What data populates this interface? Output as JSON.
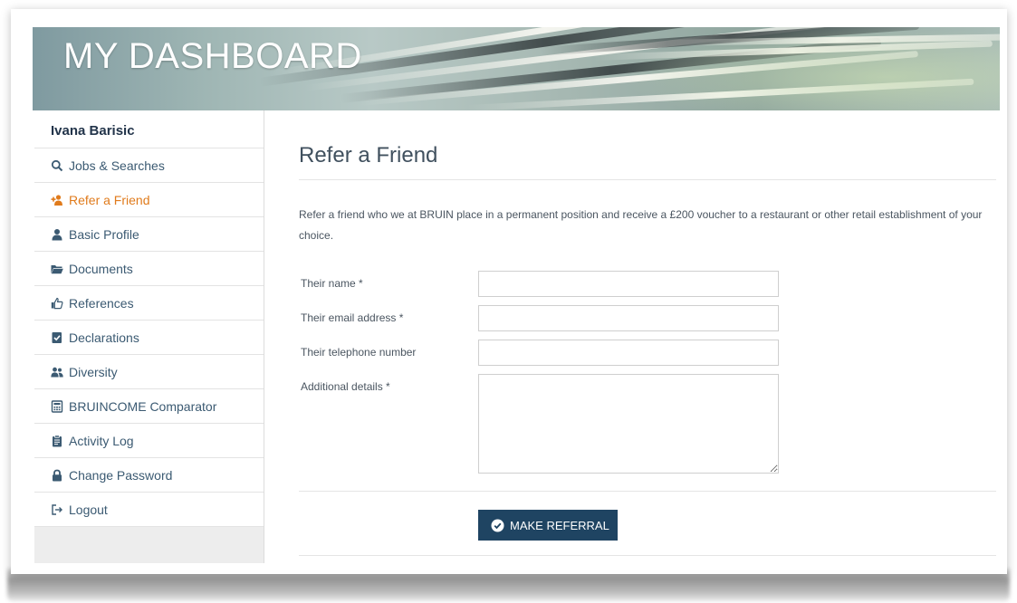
{
  "banner": {
    "title": "MY DASHBOARD"
  },
  "sidebar": {
    "user_name": "Ivana Barisic",
    "items": [
      {
        "label": "Jobs & Searches",
        "icon": "search-icon",
        "active": false
      },
      {
        "label": "Refer a Friend",
        "icon": "add-user-icon",
        "active": true
      },
      {
        "label": "Basic Profile",
        "icon": "user-icon",
        "active": false
      },
      {
        "label": "Documents",
        "icon": "folder-icon",
        "active": false
      },
      {
        "label": "References",
        "icon": "thumbs-up-icon",
        "active": false
      },
      {
        "label": "Declarations",
        "icon": "checked-document-icon",
        "active": false
      },
      {
        "label": "Diversity",
        "icon": "users-icon",
        "active": false
      },
      {
        "label": "BRUINCOME Comparator",
        "icon": "calculator-icon",
        "active": false
      },
      {
        "label": "Activity Log",
        "icon": "clipboard-icon",
        "active": false
      },
      {
        "label": "Change Password",
        "icon": "lock-icon",
        "active": false
      },
      {
        "label": "Logout",
        "icon": "logout-icon",
        "active": false
      }
    ]
  },
  "main": {
    "title": "Refer a Friend",
    "intro": "Refer a friend who we at BRUIN place in a permanent position and receive a £200 voucher to a restaurant or other retail establishment of your choice.",
    "form": {
      "name_label": "Their name *",
      "name_value": "",
      "email_label": "Their email address *",
      "email_value": "",
      "phone_label": "Their telephone number",
      "phone_value": "",
      "details_label": "Additional details *",
      "details_value": ""
    },
    "submit_label": "MAKE REFERRAL"
  },
  "colors": {
    "accent_active": "#e07b1c",
    "nav_text": "#3b5a72",
    "button_bg": "#1f4462"
  }
}
